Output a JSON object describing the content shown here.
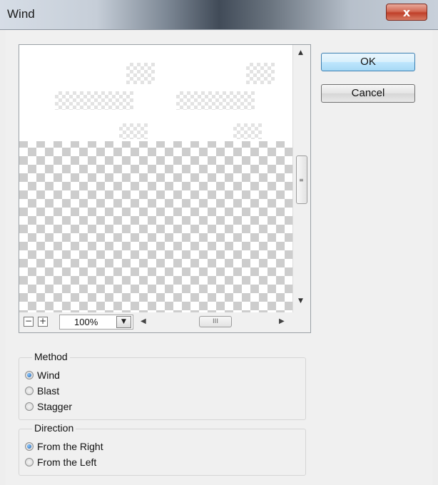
{
  "window": {
    "title": "Wind",
    "close_glyph": "x"
  },
  "preview": {
    "zoom_out_label": "−",
    "zoom_in_label": "+",
    "zoom_level": "100%",
    "scroll_up_glyph": "▲",
    "scroll_down_glyph": "▼",
    "scroll_left_glyph": "◀",
    "scroll_right_glyph": "▶",
    "dropdown_glyph": "▼",
    "vthumb_grip": "≡",
    "hthumb_grip": "III"
  },
  "buttons": {
    "ok": "OK",
    "cancel": "Cancel"
  },
  "method": {
    "label": "Method",
    "options": [
      {
        "label": "Wind",
        "selected": true
      },
      {
        "label": "Blast",
        "selected": false
      },
      {
        "label": "Stagger",
        "selected": false
      }
    ]
  },
  "direction": {
    "label": "Direction",
    "options": [
      {
        "label": "From the Right",
        "selected": true
      },
      {
        "label": "From the Left",
        "selected": false
      }
    ]
  },
  "colors": {
    "default_button": "#bee6fd",
    "close_button": "#c0402a"
  }
}
